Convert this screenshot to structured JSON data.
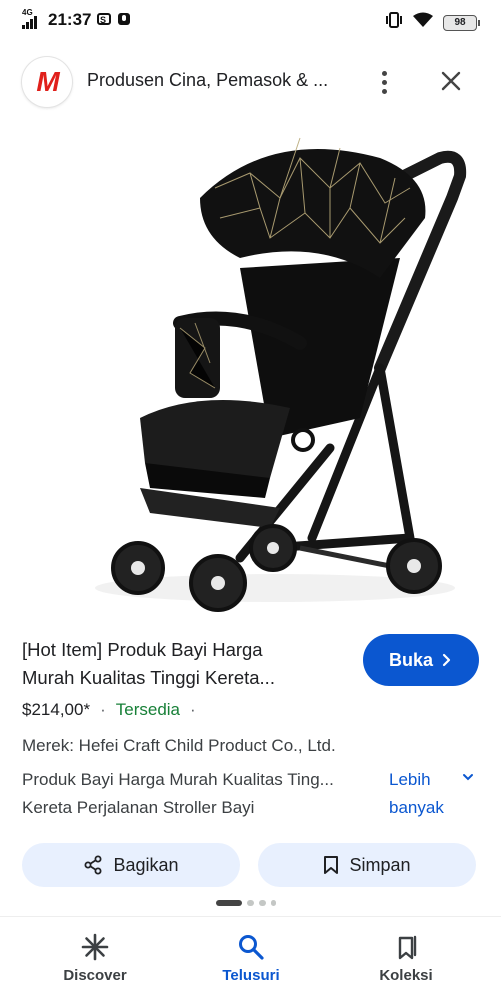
{
  "status_bar": {
    "time": "21:37",
    "network": "4G",
    "battery": "98"
  },
  "header": {
    "title": "Produsen Cina, Pemasok & ..."
  },
  "product": {
    "title_line1": "[Hot Item] Produk Bayi Harga",
    "title_line2": "Murah Kualitas Tinggi Kereta...",
    "open_button": "Buka",
    "price": "$214,00*",
    "separator": "·",
    "availability": "Tersedia",
    "brand": "Merek: Hefei Craft Child Product Co., Ltd.",
    "description_line1": "Produk Bayi Harga Murah Kualitas Ting...",
    "description_line2": "Kereta Perjalanan Stroller Bayi",
    "more_line1": "Lebih",
    "more_line2": "banyak"
  },
  "actions": {
    "share": "Bagikan",
    "save": "Simpan"
  },
  "bottom_nav": [
    {
      "label": "Discover",
      "icon": "asterisk-icon",
      "active": false
    },
    {
      "label": "Telusuri",
      "icon": "search-icon",
      "active": true
    },
    {
      "label": "Koleksi",
      "icon": "collections-icon",
      "active": false
    }
  ],
  "colors": {
    "accent": "#0b57d0",
    "available": "#188038",
    "chip": "#e8f0fe",
    "logo": "#e0201b"
  }
}
